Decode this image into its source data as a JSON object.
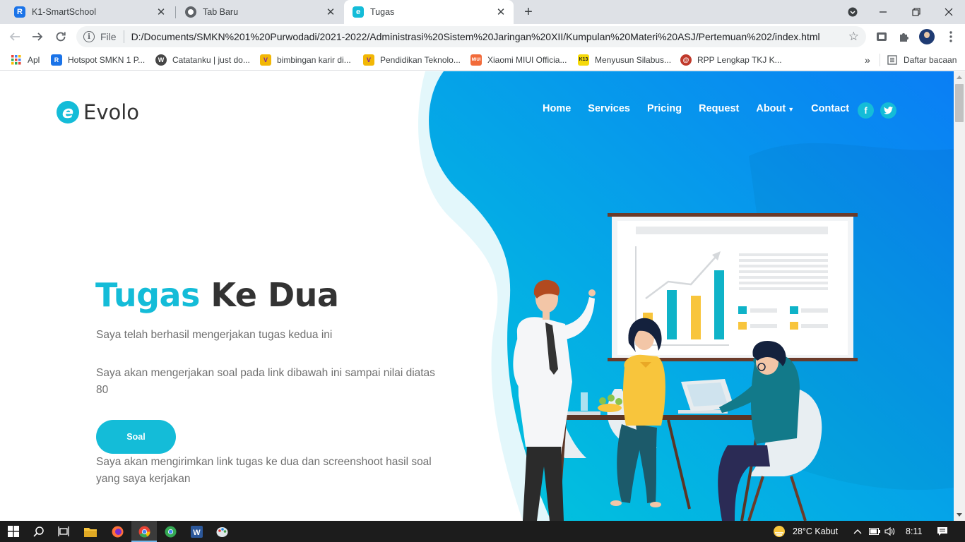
{
  "browser": {
    "tabs": [
      {
        "title": "K1-SmartSchool",
        "favicon": "R",
        "color": "#1a73e8"
      },
      {
        "title": "Tab Baru",
        "favicon": "chrome",
        "color": "#5f6368"
      },
      {
        "title": "Tugas",
        "favicon": "e",
        "color": "#14bcd8"
      }
    ],
    "address": {
      "scheme_label": "File",
      "url": "D:/Documents/SMKN%201%20Purwodadi/2021-2022/Administrasi%20Sistem%20Jaringan%20XII/Kumpulan%20Materi%20ASJ/Pertemuan%202/index.html"
    },
    "bookmarks": [
      {
        "label": "Apl",
        "icon": "apps-grid-icon"
      },
      {
        "label": "Hotspot SMKN 1 P...",
        "icon": "R",
        "color": "#1a73e8"
      },
      {
        "label": "Catatanku | just do...",
        "icon": "W",
        "color": "#464646"
      },
      {
        "label": "bimbingan karir di...",
        "icon": "V",
        "color": "#f2b705"
      },
      {
        "label": "Pendidikan Teknolo...",
        "icon": "V",
        "color": "#f2b705"
      },
      {
        "label": "Xiaomi MIUI Officia...",
        "icon": "MIUI",
        "color": "#f26b3a"
      },
      {
        "label": "Menyusun Silabus...",
        "icon": "K13",
        "color": "#f5d90a"
      },
      {
        "label": "RPP Lengkap TKJ K...",
        "icon": "@",
        "color": "#c0392b"
      }
    ],
    "bookmarks_overflow": "»",
    "reading_list": "Daftar bacaan"
  },
  "site": {
    "brand": "Evolo",
    "brand_mark": "e",
    "nav": [
      "Home",
      "Services",
      "Pricing",
      "Request",
      "About",
      "Contact"
    ],
    "social": [
      "f",
      "t"
    ],
    "title_accent": "Tugas",
    "title_rest": " Ke Dua",
    "para1": "Saya telah berhasil mengerjakan tugas kedua ini",
    "para2": "Saya akan mengerjakan soal pada link dibawah ini sampai nilai diatas 80",
    "button": "Soal",
    "para3": "Saya akan mengirimkan link tugas ke dua dan screenshoot hasil soal yang saya kerjakan"
  },
  "colors": {
    "accent": "#14bcd8",
    "gradient_start": "#00c9db",
    "gradient_end": "#0a7ef5",
    "text": "#333333",
    "muted": "#707070"
  },
  "taskbar": {
    "weather": "28°C  Kabut",
    "time": "8:11"
  }
}
